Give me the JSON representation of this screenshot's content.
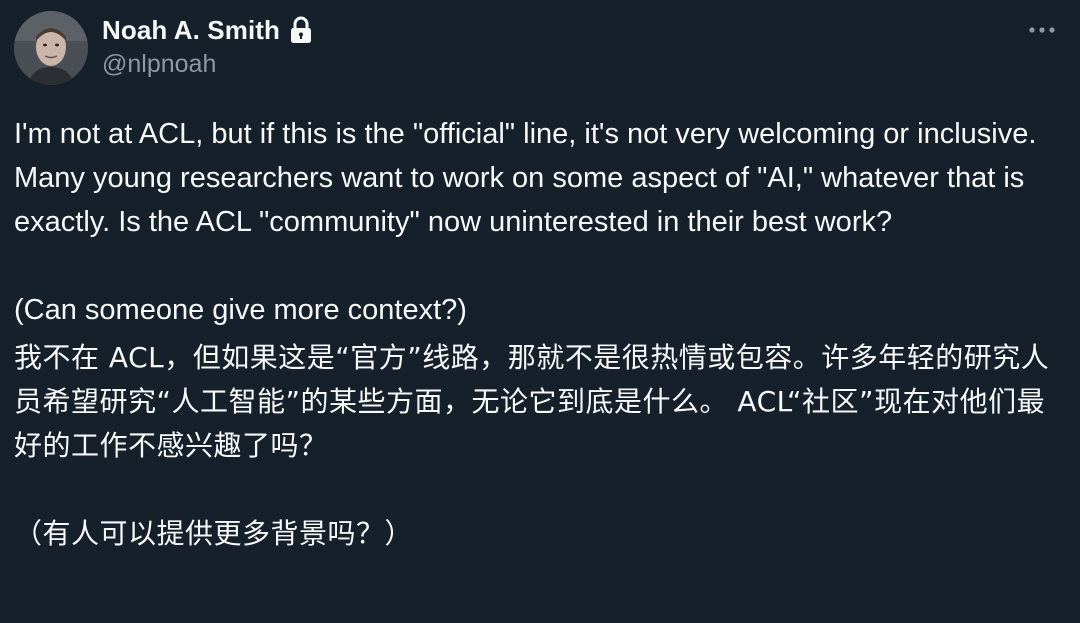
{
  "author": {
    "display_name": "Noah A. Smith",
    "handle": "@nlpnoah",
    "protected": true
  },
  "icons": {
    "lock": "lock-icon",
    "more": "more-horizontal-icon"
  },
  "tweet": {
    "paragraphs": [
      "I'm not at ACL, but if this is the \"official\" line, it's not very welcoming or inclusive.  Many young researchers want to work on some aspect of \"AI,\" whatever that is exactly.  Is the ACL \"community\" now uninterested in their best work?",
      "(Can someone give more context?)",
      "我不在 ACL，但如果这是“官方”线路，那就不是很热情或包容。许多年轻的研究人员希望研究“人工智能”的某些方面，无论它到底是什么。 ACL“社区”现在对他们最好的工作不感兴趣了吗？",
      "（有人可以提供更多背景吗？）"
    ]
  },
  "colors": {
    "background": "#15202b",
    "text_primary": "#f7f9f9",
    "text_secondary": "#8b98a5"
  }
}
